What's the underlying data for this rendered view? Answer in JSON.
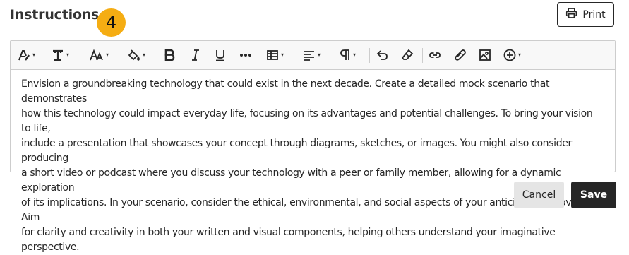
{
  "header": {
    "title": "Instructions",
    "step_badge": "4",
    "print_label": "Print"
  },
  "toolbar": {
    "buttons": [
      {
        "name": "text-style-icon",
        "has_dropdown": true
      },
      {
        "name": "paragraph-format-icon",
        "has_dropdown": true
      },
      {
        "name": "font-size-icon",
        "has_dropdown": true
      },
      {
        "name": "text-color-icon",
        "has_dropdown": true
      },
      {
        "name": "bold-icon",
        "has_dropdown": false
      },
      {
        "name": "italic-icon",
        "has_dropdown": false
      },
      {
        "name": "underline-icon",
        "has_dropdown": false
      },
      {
        "name": "more-icon",
        "has_dropdown": false
      },
      {
        "name": "table-icon",
        "has_dropdown": true
      },
      {
        "name": "align-icon",
        "has_dropdown": true
      },
      {
        "name": "paragraph-mark-icon",
        "has_dropdown": true
      },
      {
        "name": "undo-icon",
        "has_dropdown": false
      },
      {
        "name": "eraser-icon",
        "has_dropdown": false
      },
      {
        "name": "link-icon",
        "has_dropdown": false
      },
      {
        "name": "attachment-icon",
        "has_dropdown": false
      },
      {
        "name": "image-icon",
        "has_dropdown": false
      },
      {
        "name": "insert-content-icon",
        "has_dropdown": true
      }
    ]
  },
  "editor": {
    "lines": [
      "Envision a groundbreaking technology that could exist in the next decade. Create a detailed mock scenario that demonstrates",
      "how this technology could impact everyday life, focusing on its advantages and potential challenges. To bring your vision to life,",
      "include a presentation that showcases your concept through diagrams, sketches, or images. You might also consider producing",
      "a short video or podcast where you discuss your technology with a peer or family member, allowing for a dynamic exploration",
      "of its implications. In your scenario, consider the ethical, environmental, and social aspects of your anticipated innovation. Aim",
      "for clarity and creativity in both your written and visual components, helping others understand your imaginative perspective."
    ]
  },
  "footer": {
    "cancel_label": "Cancel",
    "save_label": "Save"
  },
  "colors": {
    "badge": "#f5ad13",
    "primary_button": "#262626",
    "secondary_button": "#e5e5e5",
    "border": "#cdcdcd",
    "toolbar_bg": "#f8f8f8"
  }
}
